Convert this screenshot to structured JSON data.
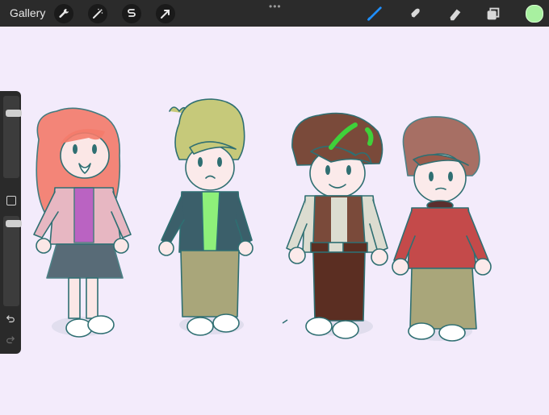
{
  "topbar": {
    "gallery_label": "Gallery",
    "left_tools": [
      {
        "name": "actions-wrench-icon"
      },
      {
        "name": "adjustments-wand-icon"
      },
      {
        "name": "selection-icon"
      },
      {
        "name": "transform-arrow-icon"
      }
    ],
    "more_label": "•••",
    "right_tools": [
      "brush-icon",
      "smudge-icon",
      "eraser-icon",
      "layers-icon"
    ],
    "current_color": "#a8f0a0",
    "active_tool": "brush"
  },
  "sidebar": {
    "brush_size_level": 0.92,
    "opacity_level": 1.0,
    "modify_button": "square",
    "undo_icon": "undo-icon",
    "redo_icon": "redo-icon"
  },
  "canvas": {
    "background": "#f3ebfb",
    "characters": [
      {
        "hair": "#f47b6a",
        "top": "#c8a0d8",
        "bottom": "#3e5560"
      },
      {
        "hair": "#c6c97a",
        "top": "#3b5f6a",
        "bottom": "#a9a67a"
      },
      {
        "hair": "#7a4a3a",
        "top": "#7a4a3a",
        "bottom": "#5b2e22"
      },
      {
        "hair": "#9a5a4a",
        "top": "#c44a4a",
        "bottom": "#a9a67a"
      }
    ]
  }
}
